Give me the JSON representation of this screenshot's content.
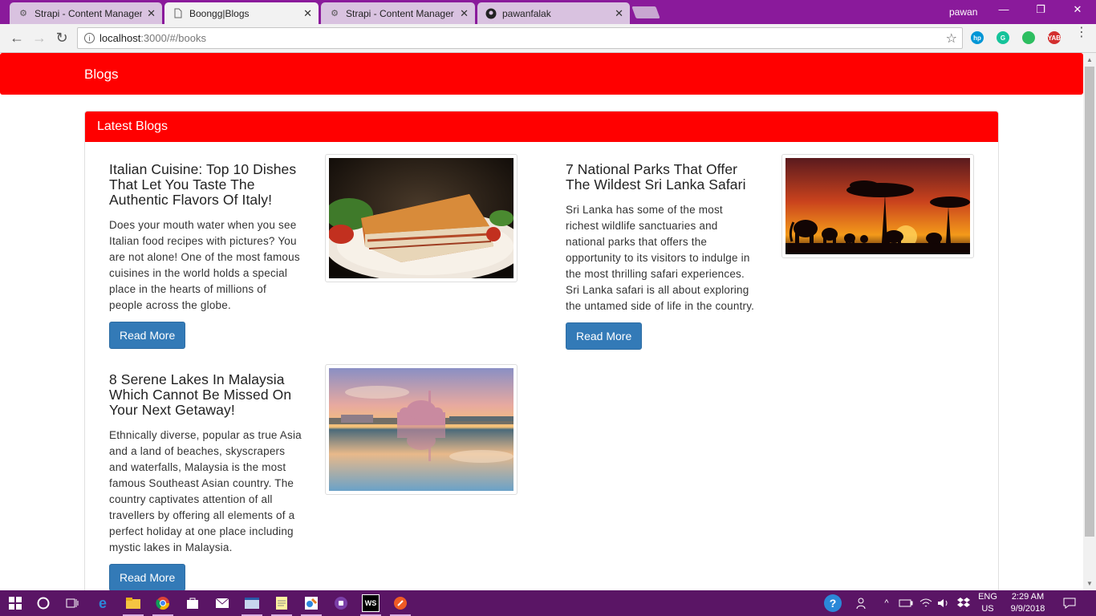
{
  "browser": {
    "tabs": [
      {
        "title": "Strapi - Content Manager",
        "icon": "strapi-icon",
        "active": false
      },
      {
        "title": "Boongg|Blogs",
        "icon": "page-icon",
        "active": true
      },
      {
        "title": "Strapi - Content Manager",
        "icon": "strapi-icon",
        "active": false
      },
      {
        "title": "pawanfalak",
        "icon": "github-icon",
        "active": false
      }
    ],
    "profile": "pawan",
    "url_host": "localhost",
    "url_path": ":3000/#/books",
    "extensions": [
      "hp-icon",
      "grammarly-icon",
      "evernote-icon",
      "yab-icon"
    ],
    "ext_yab_label": "YAB"
  },
  "navbar": {
    "brand": "Blogs"
  },
  "panel": {
    "heading": "Latest Blogs"
  },
  "posts": [
    {
      "title": "Italian Cuisine: Top 10 Dishes That Let You Taste The Authentic Flavors Of Italy!",
      "body": "Does your mouth water when you see Italian food recipes with pictures? You are not alone! One of the most famous cuisines in the world holds a special place in the hearts of millions of people across the globe.",
      "button": "Read More",
      "image": "lasagna-image"
    },
    {
      "title": "7 National Parks That Offer The Wildest Sri Lanka Safari",
      "body": "Sri Lanka has some of the most richest wildlife sanctuaries and national parks that offers the opportunity to its visitors to indulge in the most thrilling safari experiences. Sri Lanka safari is all about exploring the untamed side of life in the country.",
      "button": "Read More",
      "image": "elephant-sunset-image"
    },
    {
      "title": "8 Serene Lakes In Malaysia Which Cannot Be Missed On Your Next Getaway!",
      "body": "Ethnically diverse, popular as true Asia and a land of beaches, skyscrapers and waterfalls, Malaysia is the most famous Southeast Asian country. The country captivates attention of all travellers by offering all elements of a perfect holiday at one place including mystic lakes in Malaysia.",
      "button": "Read More",
      "image": "mosque-lake-image"
    }
  ],
  "taskbar": {
    "apps": [
      "windows-icon",
      "cortana-icon",
      "task-view-icon",
      "edge-icon",
      "file-explorer-icon",
      "chrome-icon",
      "store-icon",
      "mail-icon",
      "vscode-icon",
      "notepad-icon",
      "paint-icon",
      "app-icon",
      "webstorm-icon",
      "postman-icon"
    ],
    "webstorm_label": "WS",
    "lang_top": "ENG",
    "lang_bottom": "US",
    "time": "2:29 AM",
    "date": "9/9/2018"
  }
}
